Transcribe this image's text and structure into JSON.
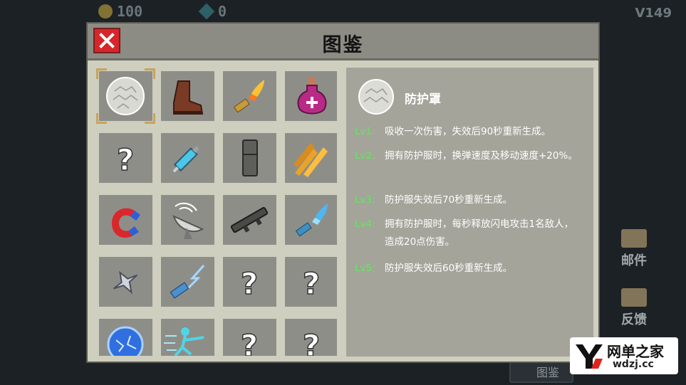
{
  "hud": {
    "coins": "100",
    "gems": "0",
    "version": "V149"
  },
  "side": {
    "mail_label": "邮件",
    "feedback_label": "反馈",
    "codex_label": "图鉴"
  },
  "modal": {
    "title": "图鉴"
  },
  "grid": [
    {
      "id": "shield",
      "name": "shield-bubble-icon",
      "selected": true
    },
    {
      "id": "boots",
      "name": "boots-icon"
    },
    {
      "id": "fire-bullet",
      "name": "fire-bullet-icon"
    },
    {
      "id": "potion",
      "name": "health-potion-icon"
    },
    {
      "id": "unknown1",
      "name": "unknown-item-icon"
    },
    {
      "id": "syringe",
      "name": "syringe-icon"
    },
    {
      "id": "magazine",
      "name": "ammo-magazine-icon"
    },
    {
      "id": "fire-arrows",
      "name": "fire-arrows-icon"
    },
    {
      "id": "magnet",
      "name": "magnet-icon"
    },
    {
      "id": "radar",
      "name": "radar-dish-icon"
    },
    {
      "id": "scope",
      "name": "rifle-scope-icon"
    },
    {
      "id": "ice-bullet",
      "name": "ice-bullet-icon"
    },
    {
      "id": "shuriken",
      "name": "shuriken-icon"
    },
    {
      "id": "lightning-bullet",
      "name": "lightning-bullet-icon"
    },
    {
      "id": "unknown2",
      "name": "unknown-item-icon"
    },
    {
      "id": "unknown3",
      "name": "unknown-item-icon"
    },
    {
      "id": "energy-orb",
      "name": "energy-orb-icon"
    },
    {
      "id": "dash",
      "name": "dash-runner-icon"
    },
    {
      "id": "unknown4",
      "name": "unknown-item-icon"
    },
    {
      "id": "unknown5",
      "name": "unknown-item-icon"
    }
  ],
  "detail": {
    "name": "防护罩",
    "levels": [
      {
        "tag": "Lv1:",
        "text": "吸收一次伤害，失效后90秒重新生成。"
      },
      {
        "tag": "Lv2:",
        "text": "拥有防护服时，换弹速度及移动速度+20%。"
      },
      {
        "tag": "Lv3:",
        "text": "防护服失效后70秒重新生成。"
      },
      {
        "tag": "Lv4:",
        "text": "拥有防护服时，每秒释放闪电攻击1名敌人，造成20点伤害。"
      },
      {
        "tag": "Lv5:",
        "text": "防护服失效后60秒重新生成。"
      }
    ]
  },
  "watermark": {
    "title": "网单之家",
    "url": "wdzj.cc"
  },
  "colors": {
    "level_tag": "#62e85e",
    "close_button": "#d6262b",
    "modal_bg": "#cfcfbf",
    "cell_bg": "#8e8e89",
    "detail_bg": "#a4a49a"
  }
}
